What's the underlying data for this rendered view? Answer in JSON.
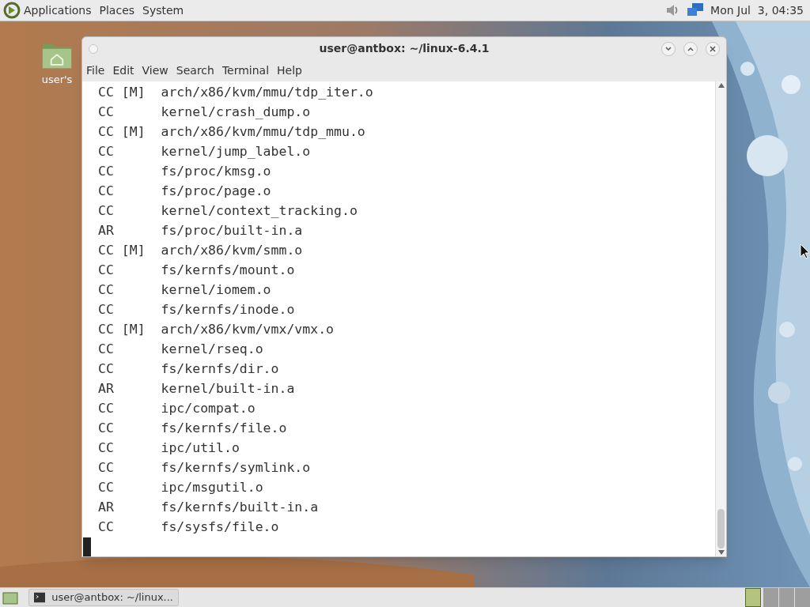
{
  "top_panel": {
    "menus": [
      "Applications",
      "Places",
      "System"
    ],
    "clock": "Mon Jul  3, 04:35"
  },
  "desktop": {
    "icons": [
      {
        "label": "user's"
      }
    ]
  },
  "window": {
    "title": "user@antbox: ~/linux-6.4.1",
    "menu": [
      "File",
      "Edit",
      "View",
      "Search",
      "Terminal",
      "Help"
    ],
    "lines": [
      "CC [M]  arch/x86/kvm/mmu/tdp_iter.o",
      "CC      kernel/crash_dump.o",
      "CC [M]  arch/x86/kvm/mmu/tdp_mmu.o",
      "CC      kernel/jump_label.o",
      "CC      fs/proc/kmsg.o",
      "CC      fs/proc/page.o",
      "CC      kernel/context_tracking.o",
      "AR      fs/proc/built-in.a",
      "CC [M]  arch/x86/kvm/smm.o",
      "CC      fs/kernfs/mount.o",
      "CC      kernel/iomem.o",
      "CC      fs/kernfs/inode.o",
      "CC [M]  arch/x86/kvm/vmx/vmx.o",
      "CC      kernel/rseq.o",
      "CC      fs/kernfs/dir.o",
      "AR      kernel/built-in.a",
      "CC      ipc/compat.o",
      "CC      fs/kernfs/file.o",
      "CC      ipc/util.o",
      "CC      fs/kernfs/symlink.o",
      "CC      ipc/msgutil.o",
      "AR      fs/kernfs/built-in.a",
      "CC      fs/sysfs/file.o"
    ]
  },
  "bottom_panel": {
    "tasks": [
      {
        "label": "user@antbox: ~/linux..."
      }
    ],
    "workspaces": [
      {
        "selected": true
      },
      {
        "selected": false
      },
      {
        "selected": false
      },
      {
        "selected": false
      }
    ]
  }
}
